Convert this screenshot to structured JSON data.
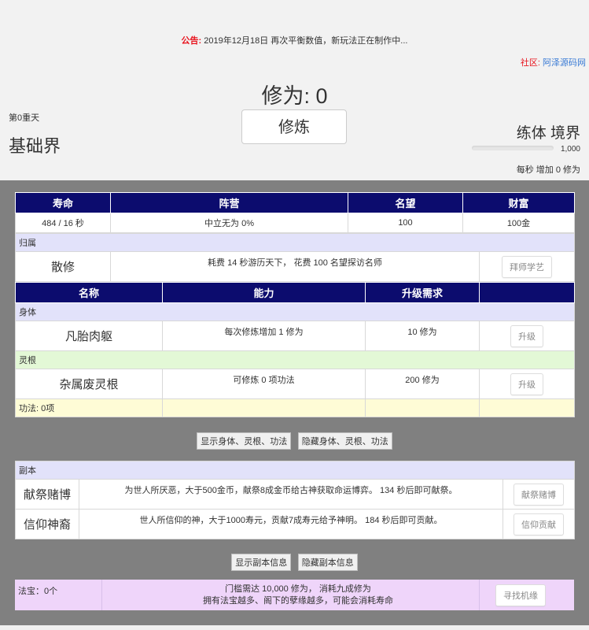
{
  "notice": {
    "label": "公告:",
    "text": "2019年12月18日 再次平衡数值，新玩法正在制作中..."
  },
  "community": {
    "label": "社区:",
    "link": "阿泽源码网"
  },
  "cultivation": {
    "label": "修为: 0"
  },
  "cultivate_button": "修炼",
  "heaven": "第0重天",
  "world": "基础界",
  "realm": "练体 境界",
  "progress": {
    "max_label": "1,000",
    "fraction": 0
  },
  "rate": "每秒 增加 0 修为",
  "stats": {
    "headers": [
      "寿命",
      "阵营",
      "名望",
      "财富"
    ],
    "values": [
      "484 / 16 秒",
      "中立无为 0%",
      "100",
      "100金"
    ]
  },
  "belong": {
    "section": "归属",
    "name": "散修",
    "desc": "耗费 14 秒游历天下， 花费 100 名望探访名师",
    "button": "拜师学艺"
  },
  "ability": {
    "headers": [
      "名称",
      "能力",
      "升级需求",
      ""
    ],
    "body_section": "身体",
    "body": {
      "name": "凡胎肉躯",
      "desc": "每次修炼增加 1 修为",
      "req": "10 修为",
      "button": "升级"
    },
    "root_section": "灵根",
    "root": {
      "name": "杂属废灵根",
      "desc": "可修炼 0 项功法",
      "req": "200 修为",
      "button": "升级"
    },
    "skill_section": "功法: 0项"
  },
  "buttons1": {
    "show": "显示身体、灵根、功法",
    "hide": "隐藏身体、灵根、功法"
  },
  "dungeon": {
    "section": "副本",
    "rows": [
      {
        "name": "献祭赌博",
        "desc": "为世人所厌恶，大于500金币，献祭8成金币给古神获取命运博弈。 134 秒后即可献祭。",
        "button": "献祭赌博"
      },
      {
        "name": "信仰神裔",
        "desc": "世人所信仰的神，大于1000寿元，贡献7成寿元给予神明。 184 秒后即可贡献。",
        "button": "信仰贡献"
      }
    ]
  },
  "buttons2": {
    "show": "显示副本信息",
    "hide": "隐藏副本信息"
  },
  "treasure": {
    "label": "法宝：0个",
    "line1": "门槛需达 10,000 修为， 消耗九成修为",
    "line2": "拥有法宝越多、阁下的孽缘越多，可能会消耗寿命",
    "button": "寻找机缘"
  }
}
